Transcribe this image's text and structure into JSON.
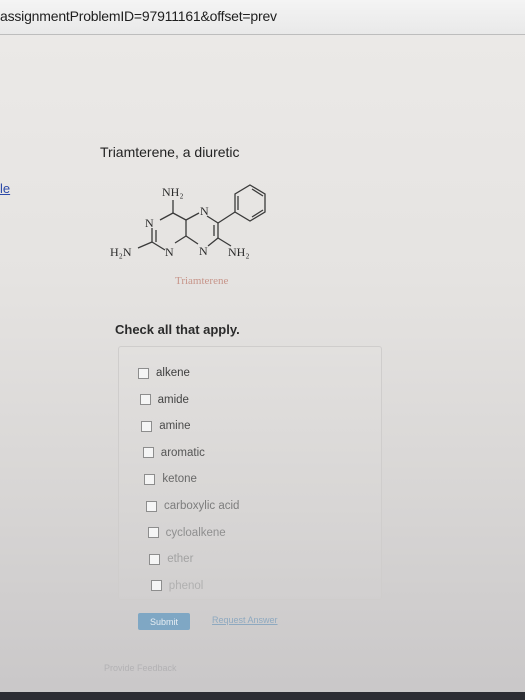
{
  "browser": {
    "url": "assignmentProblemID=97911161&offset=prev"
  },
  "sidebar": {
    "tab_label": "le"
  },
  "problem": {
    "title": "Triamterene, a diuretic",
    "molecule": {
      "nh2_top": "NH₂",
      "n_ring1": "N",
      "n_ring2": "N",
      "h2n": "H₂N",
      "n_bottom1": "N",
      "n_bottom2": "N",
      "nh2_right": "NH₂",
      "caption": "Triamterene"
    },
    "prompt": "Check all that apply.",
    "options": [
      "alkene",
      "amide",
      "amine",
      "aromatic",
      "ketone",
      "carboxylic acid",
      "cycloalkene",
      "ether",
      "phenol"
    ]
  },
  "actions": {
    "submit_label": "Submit",
    "request_answer_label": "Request Answer",
    "feedback_label": "Provide Feedback"
  }
}
